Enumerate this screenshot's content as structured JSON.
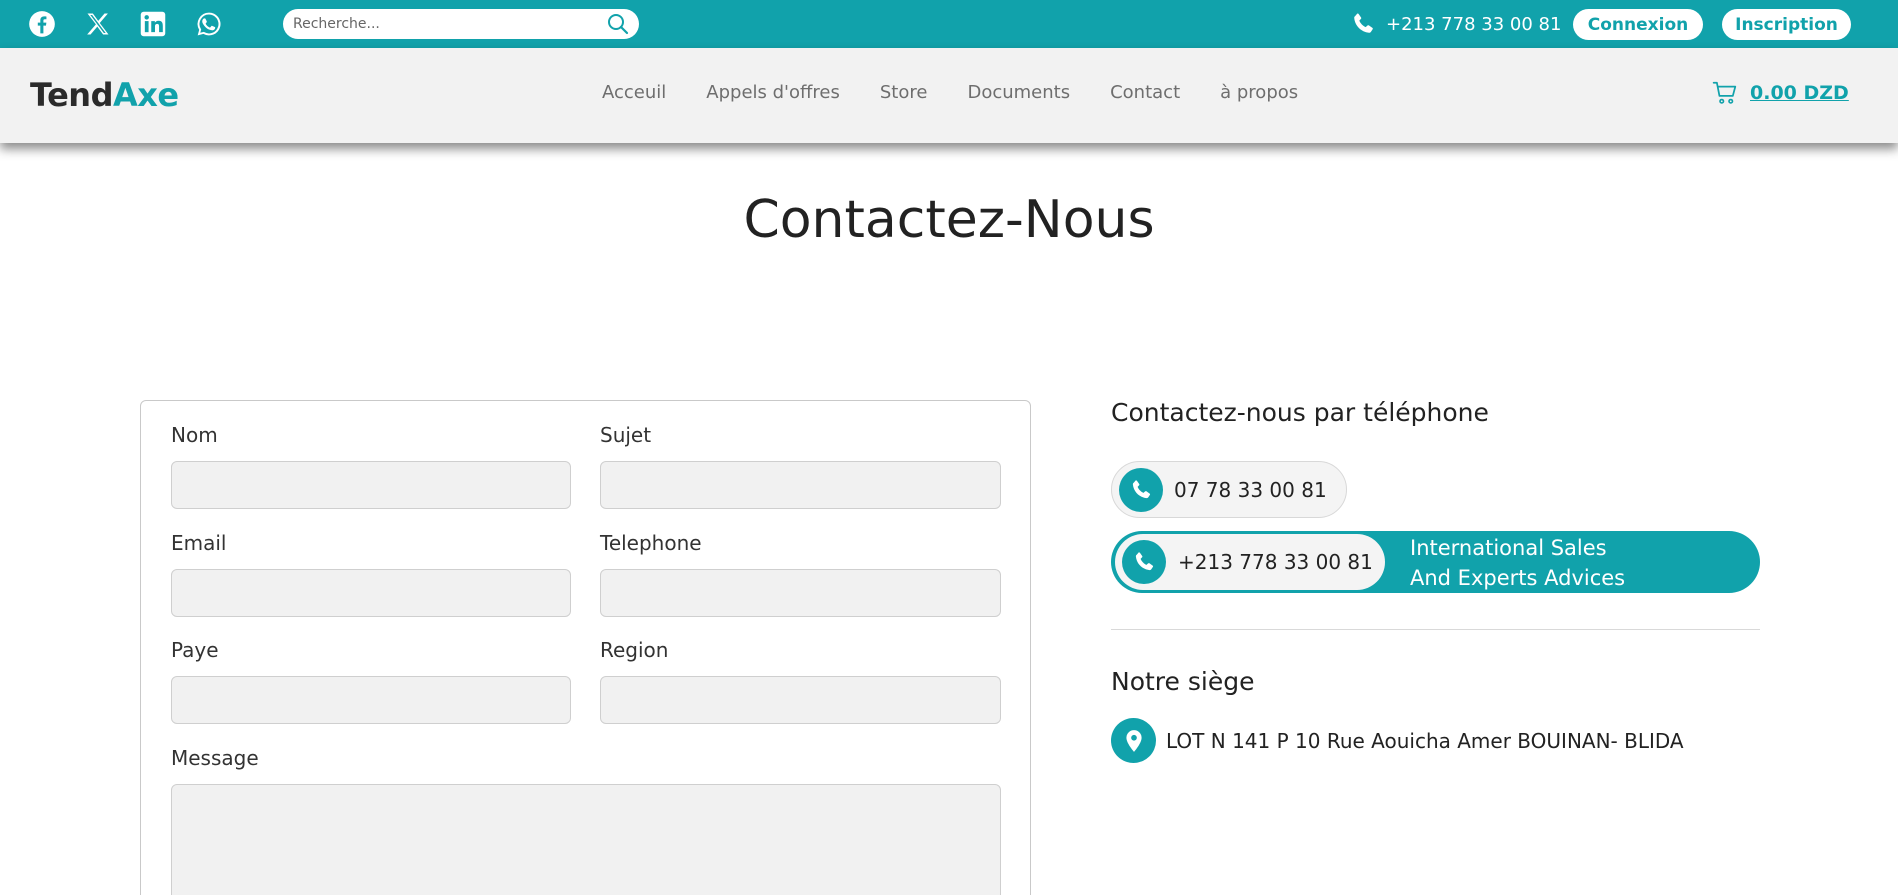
{
  "colors": {
    "accent": "#11a2ab",
    "header_bg": "#f2f2f2",
    "input_bg": "#f1f1f1"
  },
  "topbar": {
    "social_icons": [
      "facebook-icon",
      "x-twitter-icon",
      "linkedin-icon",
      "whatsapp-icon"
    ],
    "search_placeholder": "Recherche...",
    "phone": "+213 778 33 00 81",
    "login_label": "Connexion",
    "signup_label": "Inscription"
  },
  "header": {
    "logo_part1": "Tend",
    "logo_part2": "Axe",
    "nav": [
      "Acceuil",
      "Appels d'offres",
      "Store",
      "Documents",
      "Contact",
      "à propos"
    ],
    "cart_total": "0.00 DZD"
  },
  "page": {
    "title": "Contactez-Nous"
  },
  "form": {
    "name_label": "Nom",
    "subject_label": "Sujet",
    "email_label": "Email",
    "phone_label": "Telephone",
    "country_label": "Paye",
    "region_label": "Region",
    "message_label": "Message"
  },
  "contact": {
    "phone_heading": "Contactez-nous par téléphone",
    "local_phone": "07 78 33 00 81",
    "intl_phone": "+213 778 33 00 81",
    "intl_line1": "International Sales",
    "intl_line2": "And Experts Advices",
    "hq_heading": "Notre siège",
    "address": "LOT N 141 P 10 Rue Aouicha Amer BOUINAN- BLIDA"
  }
}
